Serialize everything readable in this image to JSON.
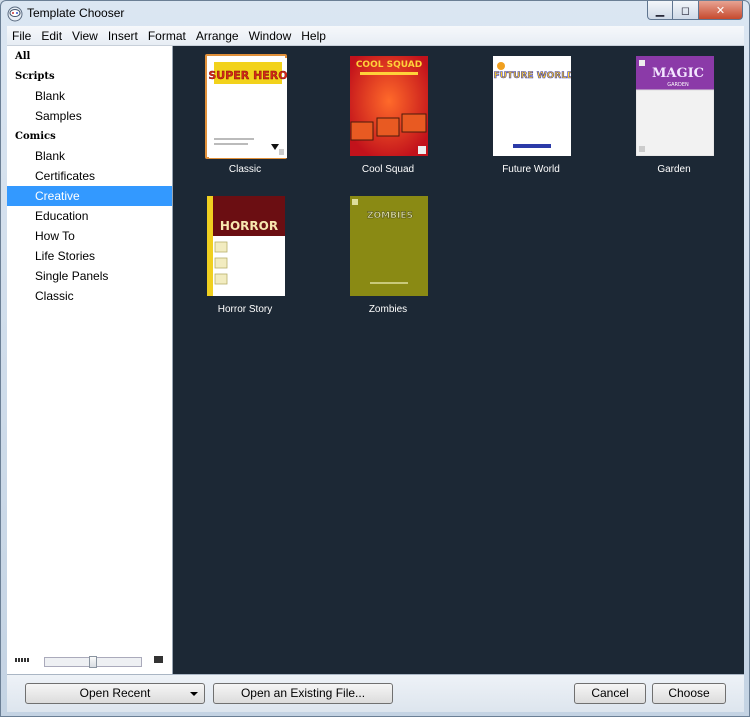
{
  "window": {
    "title": "Template Chooser"
  },
  "menu": [
    "File",
    "Edit",
    "View",
    "Insert",
    "Format",
    "Arrange",
    "Window",
    "Help"
  ],
  "sidebar": {
    "all_label": "All",
    "scripts_label": "Scripts",
    "scripts_items": [
      "Blank",
      "Samples"
    ],
    "comics_label": "Comics",
    "comics_items": [
      "Blank",
      "Certificates",
      "Creative",
      "Education",
      "How To",
      "Life Stories",
      "Single Panels",
      "Classic"
    ],
    "selected": "Creative",
    "zoom_level": 0.5
  },
  "templates": [
    {
      "label": "Classic",
      "cover_text": "SUPER HERO",
      "selected": true
    },
    {
      "label": "Cool Squad",
      "cover_text": "COOL SQUAD"
    },
    {
      "label": "Future World",
      "cover_text": "FUTURE WORLD"
    },
    {
      "label": "Garden",
      "cover_text": "MAGIC",
      "cover_sub": "GARDEN"
    },
    {
      "label": "Horror Story",
      "cover_text": "HORROR"
    },
    {
      "label": "Zombies",
      "cover_text": "ZOMBIES"
    }
  ],
  "footer": {
    "open_recent": "Open Recent",
    "open_existing": "Open an Existing File...",
    "cancel": "Cancel",
    "choose": "Choose"
  },
  "colors": {
    "content_bg": "#1c2835",
    "selection": "#3399ff",
    "selected_tile_border": "#e0903a"
  }
}
